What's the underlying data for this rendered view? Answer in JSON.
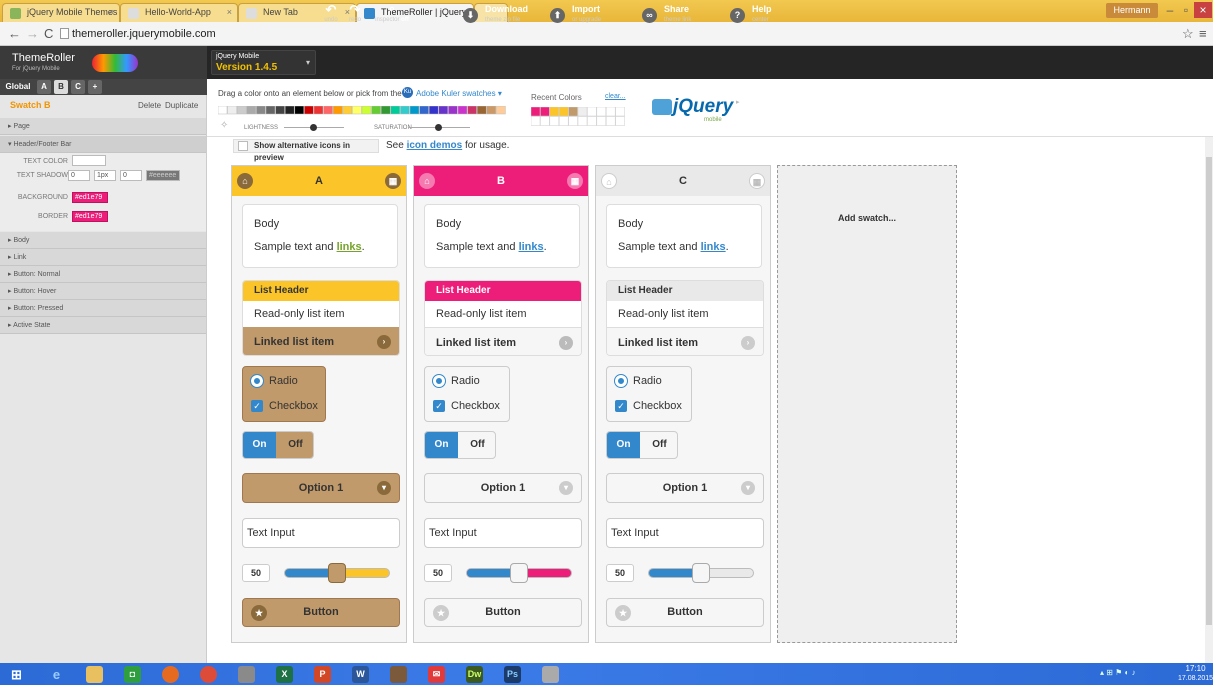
{
  "browser": {
    "tabs": [
      {
        "title": "jQuery Mobile Themes",
        "active": false
      },
      {
        "title": "Hello-World-App",
        "active": false
      },
      {
        "title": "New Tab",
        "active": false
      },
      {
        "title": "ThemeRoller | jQuery Mol",
        "active": true
      }
    ],
    "user": "Hermann",
    "url": "themeroller.jquerymobile.com"
  },
  "header": {
    "logo_title": "ThemeRoller",
    "logo_sub": "For jQuery Mobile",
    "version_small": "jQuery Mobile",
    "version": "Version 1.4.5",
    "undo": "undo",
    "redo": "redo",
    "inspector": "inspector",
    "inspector_state": "off",
    "download": "Download",
    "download_sub": "theme zip file",
    "import": "Import",
    "import_sub": "or upgrade",
    "share": "Share",
    "share_sub": "theme link",
    "help": "Help",
    "help_sub": "center"
  },
  "sidebar": {
    "tabs": [
      "Global",
      "A",
      "B",
      "C",
      "+"
    ],
    "active_tab": "B",
    "swatch_title": "Swatch B",
    "delete": "Delete",
    "duplicate": "Duplicate",
    "sections": [
      "Page",
      "Header/Footer Bar",
      "Body",
      "Link",
      "Button: Normal",
      "Button: Hover",
      "Button: Pressed",
      "Active State"
    ],
    "fields": {
      "text_color_label": "TEXT COLOR",
      "text_shadow_label": "TEXT SHADOW",
      "shadow_x": "0",
      "shadow_y": "1px",
      "shadow_blur": "0",
      "shadow_color": "#eeeeee",
      "background_label": "BACKGROUND",
      "background_value": "#ed1e79",
      "border_label": "BORDER",
      "border_value": "#ed1e79"
    }
  },
  "toolbar": {
    "drag_text": "Drag a color onto an element below or pick from the",
    "kuler": "Adobe Kuler swatches ▾",
    "recent": "Recent Colors",
    "clear": "clear...",
    "lightness": "LIGHTNESS",
    "saturation": "SATURATION",
    "alt_icons": "Show alternative icons in preview",
    "see": "See",
    "icon_demos": "icon demos",
    "for_usage": "for usage.",
    "jquery_logo": "jQuery",
    "jquery_sub": "mobile"
  },
  "swatches": [
    {
      "name": "A",
      "body": "Body",
      "sample": "Sample text and",
      "link": "links",
      "list_header": "List Header",
      "readonly": "Read-only list item",
      "linked": "Linked list item",
      "radio": "Radio",
      "checkbox": "Checkbox",
      "on": "On",
      "off": "Off",
      "option": "Option 1",
      "input": "Text Input",
      "slider": "50",
      "button": "Button"
    },
    {
      "name": "B",
      "body": "Body",
      "sample": "Sample text and",
      "link": "links",
      "list_header": "List Header",
      "readonly": "Read-only list item",
      "linked": "Linked list item",
      "radio": "Radio",
      "checkbox": "Checkbox",
      "on": "On",
      "off": "Off",
      "option": "Option 1",
      "input": "Text Input",
      "slider": "50",
      "button": "Button"
    },
    {
      "name": "C",
      "body": "Body",
      "sample": "Sample text and",
      "link": "links",
      "list_header": "List Header",
      "readonly": "Read-only list item",
      "linked": "Linked list item",
      "radio": "Radio",
      "checkbox": "Checkbox",
      "on": "On",
      "off": "Off",
      "option": "Option 1",
      "input": "Text Input",
      "slider": "50",
      "button": "Button"
    }
  ],
  "add_swatch": "Add swatch...",
  "colors": {
    "a_accent": "#fbc52a",
    "a_brown": "#c19a6b",
    "b_accent": "#ed1e79",
    "blue": "#3388cc"
  },
  "taskbar": {
    "time": "17:10",
    "date": "17.08.2015"
  }
}
